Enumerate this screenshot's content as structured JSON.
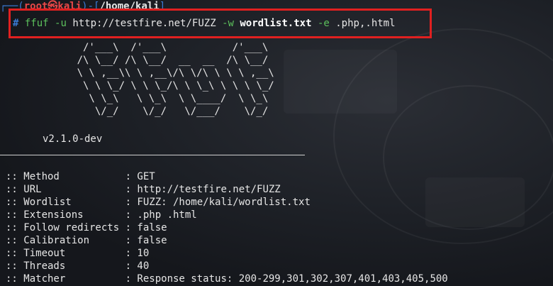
{
  "prompt": {
    "bracket_open": "┌──(",
    "user": "root㉿kali",
    "bracket_mid": ")-[",
    "dir": "/home/kali",
    "bracket_close": "]"
  },
  "command": {
    "hash": "#",
    "program": "ffuf",
    "flag_u": "-u",
    "url": "http://testfire.net/FUZZ",
    "flag_w": "-w",
    "wordlist": "wordlist.txt",
    "flag_e": "-e",
    "extensions": ".php,.html"
  },
  "banner": {
    "ascii_art": "       /'___\\  /'___\\           /'___\\\n      /\\ \\__/ /\\ \\__/  __  __  /\\ \\__/\n      \\ \\ ,__\\\\ \\ ,__\\/\\ \\/\\ \\ \\ \\ ,__\\\n       \\ \\ \\_/ \\ \\ \\_/\\ \\ \\_\\ \\ \\ \\ \\_/\n        \\ \\_\\   \\ \\_\\  \\ \\____/  \\ \\_\\\n         \\/_/    \\/_/   \\/___/    \\/_/",
    "version": "v2.1.0-dev"
  },
  "config": [
    {
      "key": ":: Method           ",
      "value": ": GET"
    },
    {
      "key": ":: URL              ",
      "value": ": http://testfire.net/FUZZ"
    },
    {
      "key": ":: Wordlist         ",
      "value": ": FUZZ: /home/kali/wordlist.txt"
    },
    {
      "key": ":: Extensions       ",
      "value": ": .php .html"
    },
    {
      "key": ":: Follow redirects ",
      "value": ": false"
    },
    {
      "key": ":: Calibration      ",
      "value": ": false"
    },
    {
      "key": ":: Timeout          ",
      "value": ": 10"
    },
    {
      "key": ":: Threads          ",
      "value": ": 40"
    },
    {
      "key": ":: Matcher          ",
      "value": ": Response status: 200-299,301,302,307,401,403,405,500"
    }
  ],
  "colors": {
    "highlight_border": "#e02020",
    "prompt_bracket": "#3a7bd5",
    "prompt_user": "#e74848",
    "command": "#5cc05c"
  }
}
